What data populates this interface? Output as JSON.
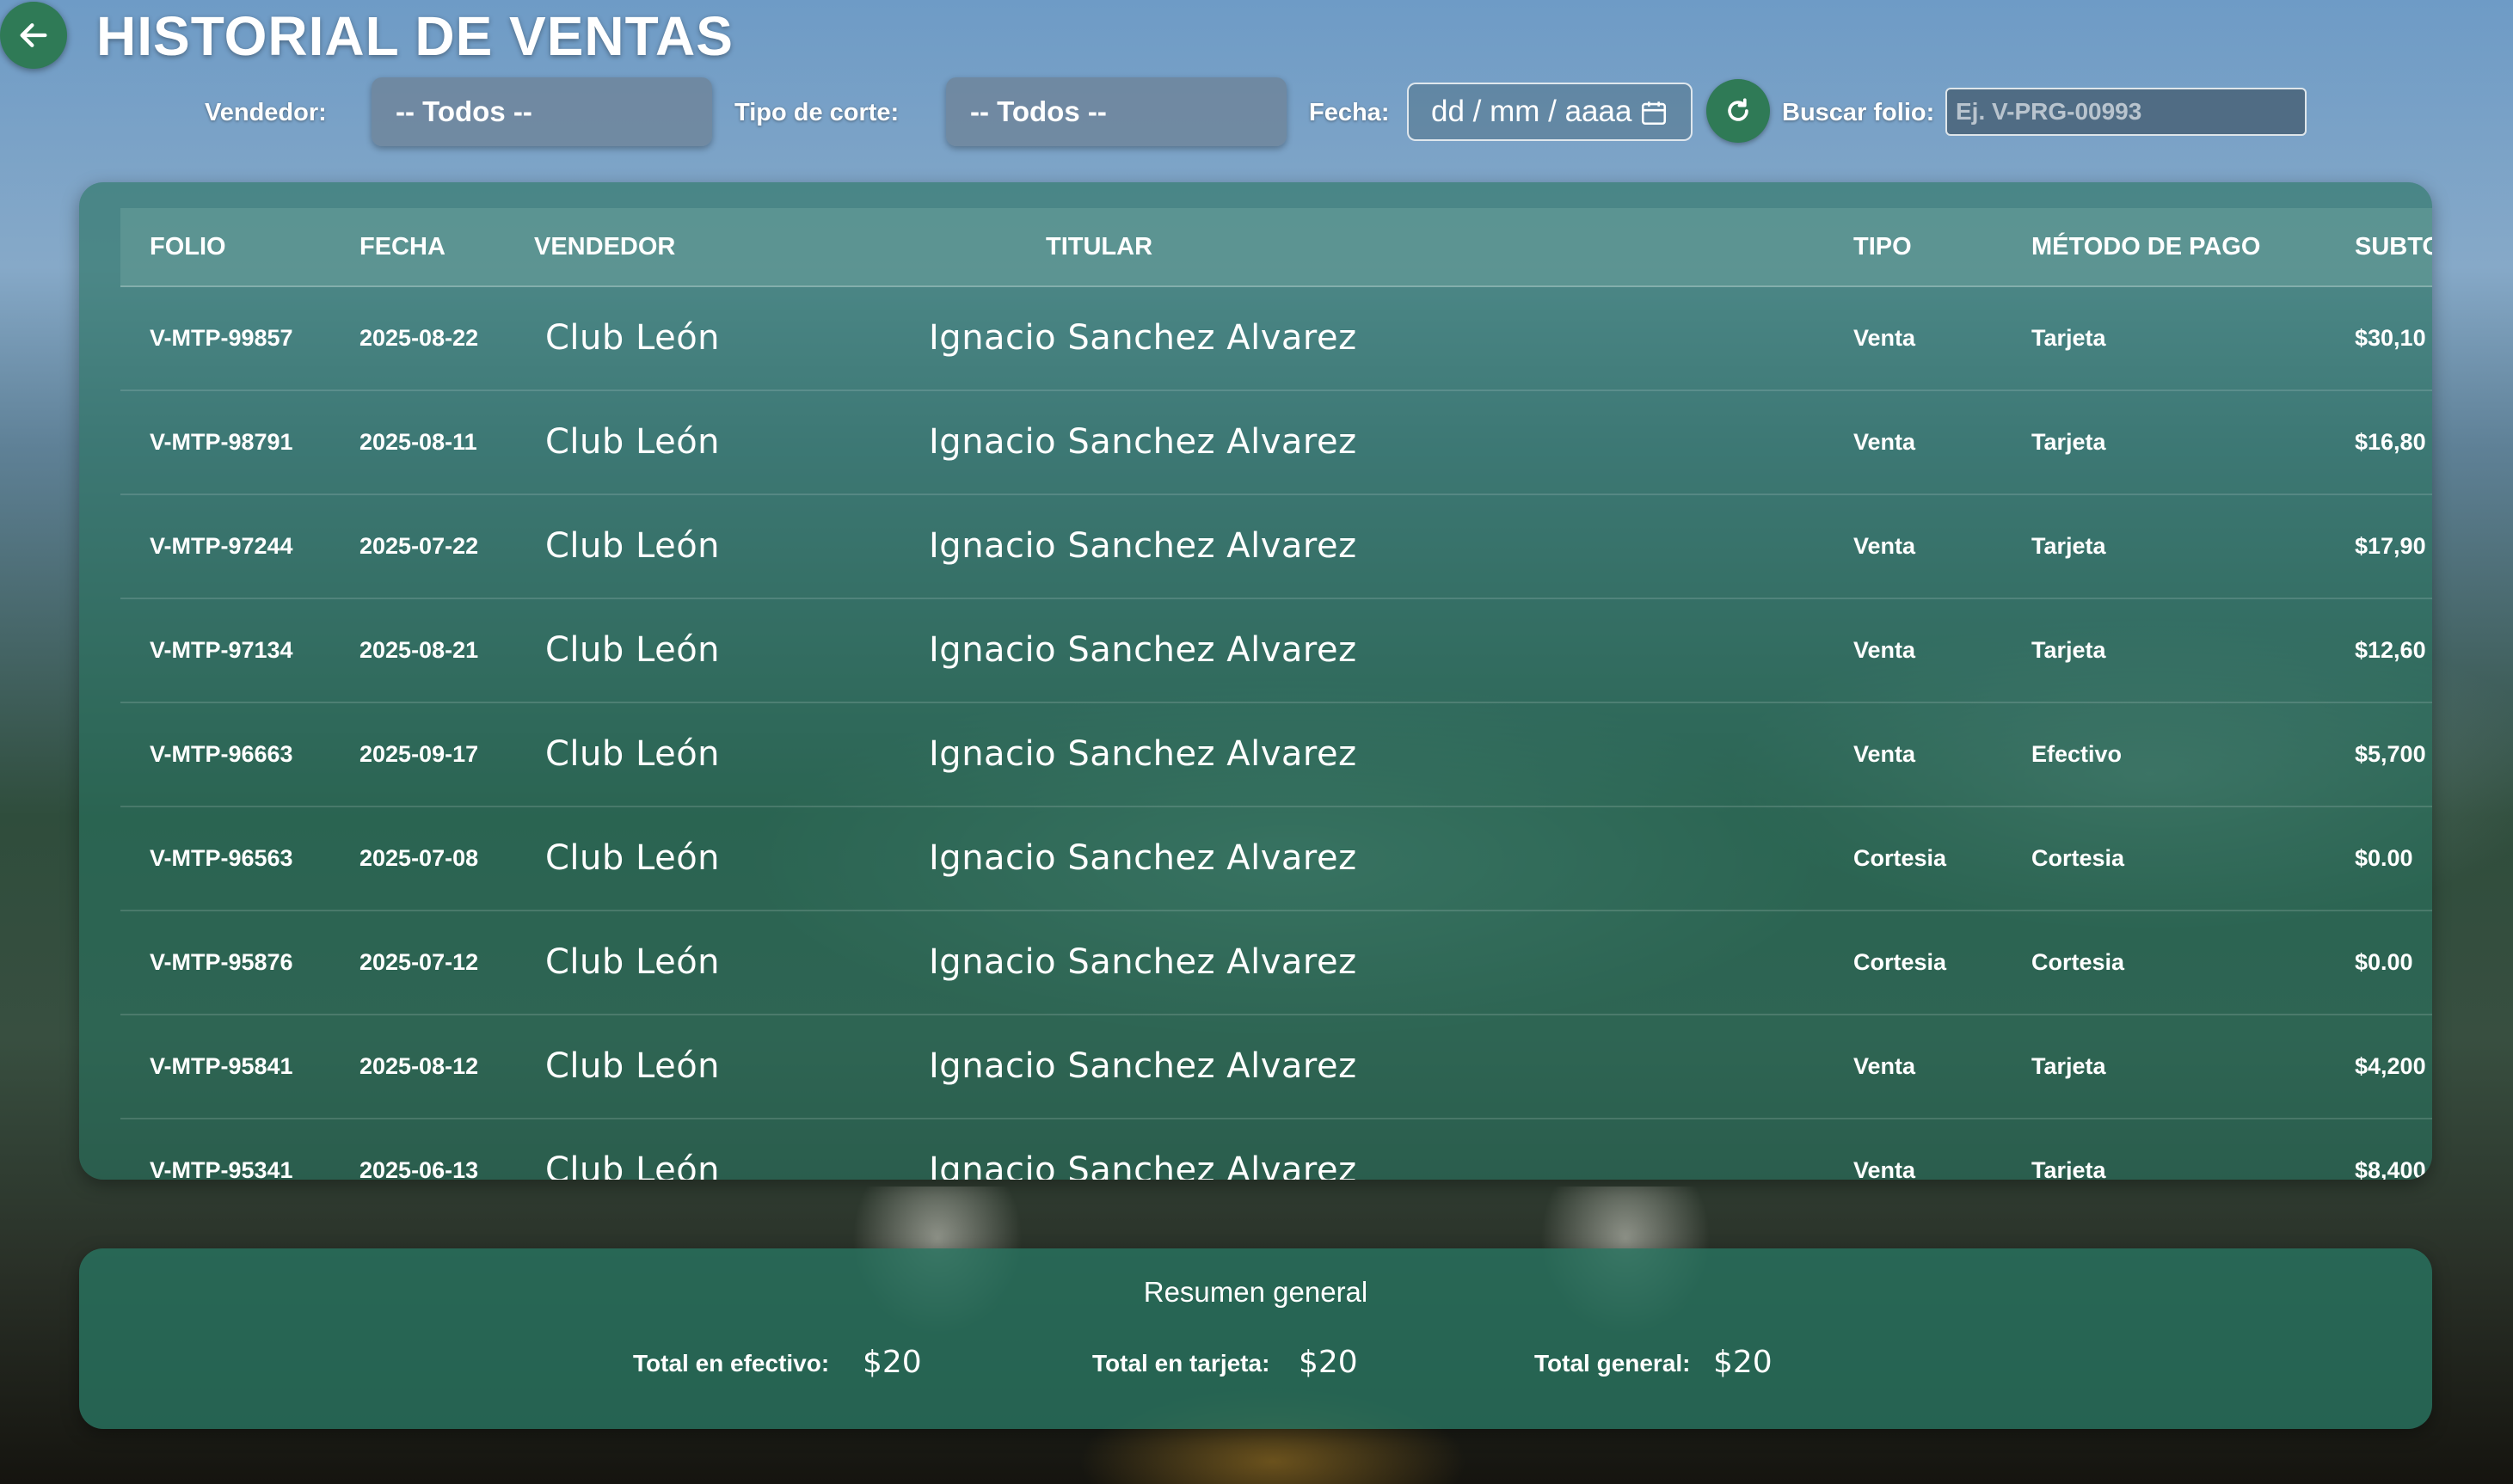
{
  "header": {
    "title": "HISTORIAL DE VENTAS",
    "back_icon": "arrow-left-icon"
  },
  "filters": {
    "vendedor_label": "Vendedor:",
    "vendedor_value": "-- Todos --",
    "tipo_corte_label": "Tipo de corte:",
    "tipo_corte_value": "-- Todos --",
    "fecha_label": "Fecha:",
    "fecha_placeholder": "dd / mm / aaaa",
    "buscar_label": "Buscar folio:",
    "buscar_placeholder": "Ej. V-PRG-00993"
  },
  "table": {
    "columns": [
      "FOLIO",
      "FECHA",
      "VENDEDOR",
      "TITULAR",
      "TIPO",
      "MÉTODO DE PAGO",
      "SUBTO"
    ],
    "rows": [
      {
        "folio": "V-MTP-99857",
        "fecha": "2025-08-22",
        "vendedor": "Club León",
        "titular": "Ignacio Sanchez Alvarez",
        "tipo": "Venta",
        "metodo": "Tarjeta",
        "subtotal": "$30,10"
      },
      {
        "folio": "V-MTP-98791",
        "fecha": "2025-08-11",
        "vendedor": "Club León",
        "titular": "Ignacio Sanchez Alvarez",
        "tipo": "Venta",
        "metodo": "Tarjeta",
        "subtotal": "$16,80"
      },
      {
        "folio": "V-MTP-97244",
        "fecha": "2025-07-22",
        "vendedor": "Club León",
        "titular": "Ignacio Sanchez Alvarez",
        "tipo": "Venta",
        "metodo": "Tarjeta",
        "subtotal": "$17,90"
      },
      {
        "folio": "V-MTP-97134",
        "fecha": "2025-08-21",
        "vendedor": "Club León",
        "titular": "Ignacio Sanchez Alvarez",
        "tipo": "Venta",
        "metodo": "Tarjeta",
        "subtotal": "$12,60"
      },
      {
        "folio": "V-MTP-96663",
        "fecha": "2025-09-17",
        "vendedor": "Club León",
        "titular": "Ignacio Sanchez Alvarez",
        "tipo": "Venta",
        "metodo": "Efectivo",
        "subtotal": "$5,700"
      },
      {
        "folio": "V-MTP-96563",
        "fecha": "2025-07-08",
        "vendedor": "Club León",
        "titular": "Ignacio Sanchez Alvarez",
        "tipo": "Cortesia",
        "metodo": "Cortesia",
        "subtotal": "$0.00"
      },
      {
        "folio": "V-MTP-95876",
        "fecha": "2025-07-12",
        "vendedor": "Club León",
        "titular": "Ignacio Sanchez Alvarez",
        "tipo": "Cortesia",
        "metodo": "Cortesia",
        "subtotal": "$0.00"
      },
      {
        "folio": "V-MTP-95841",
        "fecha": "2025-08-12",
        "vendedor": "Club León",
        "titular": "Ignacio Sanchez Alvarez",
        "tipo": "Venta",
        "metodo": "Tarjeta",
        "subtotal": "$4,200"
      },
      {
        "folio": "V-MTP-95341",
        "fecha": "2025-06-13",
        "vendedor": "Club León",
        "titular": "Ignacio Sanchez Alvarez",
        "tipo": "Venta",
        "metodo": "Tarjeta",
        "subtotal": "$8,400"
      }
    ]
  },
  "summary": {
    "title": "Resumen general",
    "efectivo_label": "Total en efectivo:",
    "efectivo_value": "$20",
    "tarjeta_label": "Total en tarjeta:",
    "tarjeta_value": "$20",
    "general_label": "Total general:",
    "general_value": "$20"
  },
  "colors": {
    "accent": "#2f7a56",
    "panel": "#28735f"
  }
}
